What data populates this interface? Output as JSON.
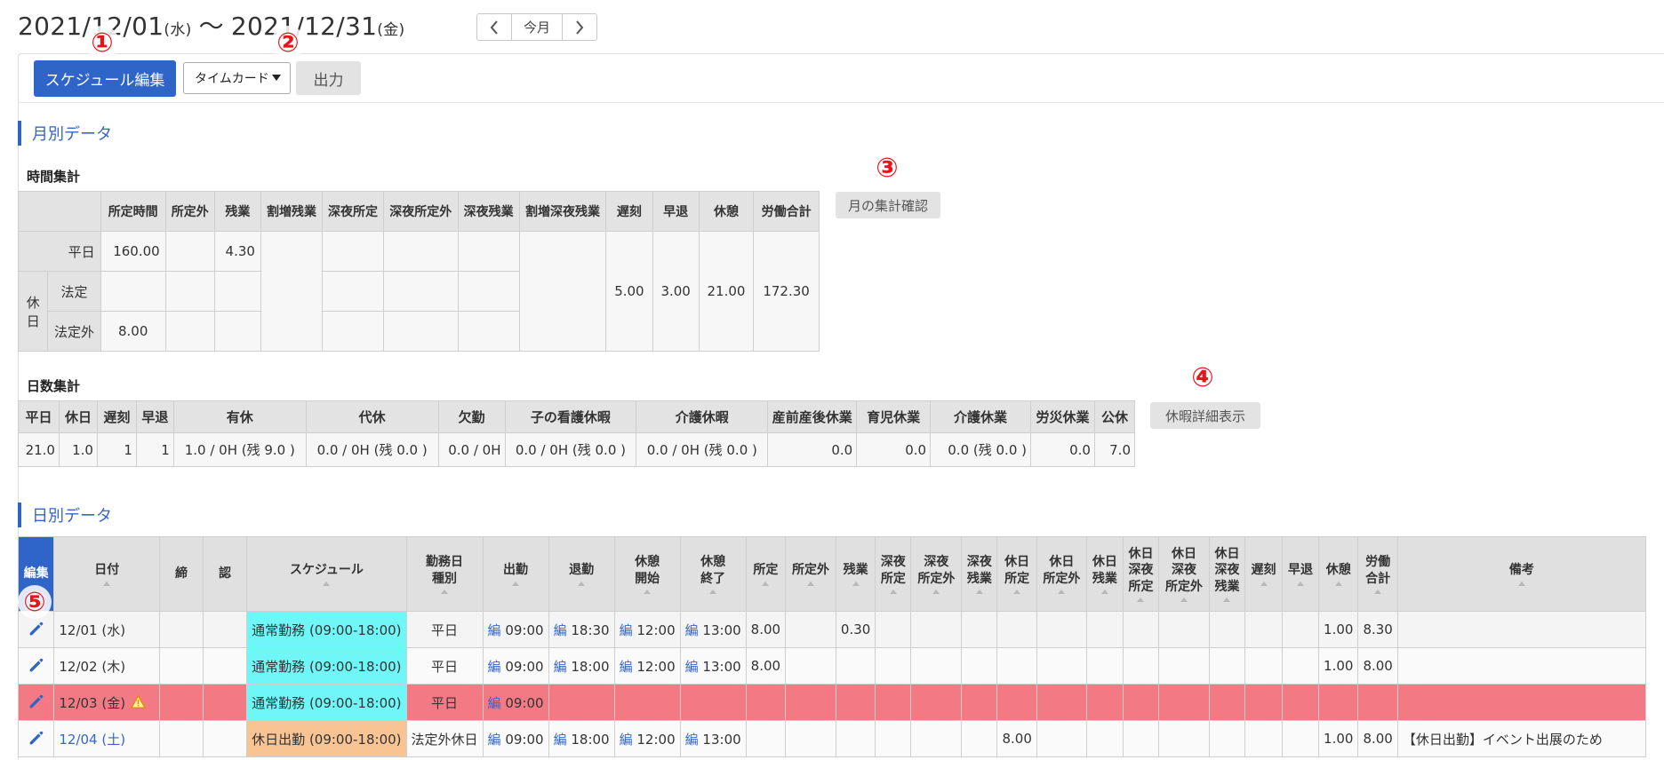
{
  "header": {
    "start_date": "2021/12/01",
    "start_dow": "(水)",
    "tilde": "〜",
    "end_date": "2021/12/31",
    "end_dow": "(金)",
    "nav_prev_icon": "chevron-left-icon",
    "nav_today": "今月",
    "nav_next_icon": "chevron-right-icon"
  },
  "toolbar": {
    "schedule_edit_label": "スケジュール編集",
    "select_value": "タイムカード",
    "output_label": "出力"
  },
  "markers": [
    "①",
    "②",
    "③",
    "④",
    "⑤"
  ],
  "monthly": {
    "section_title": "月別データ",
    "time_title": "時間集計",
    "time_headers": [
      "所定時間",
      "所定外",
      "残業",
      "割増残業",
      "深夜所定",
      "深夜所定外",
      "深夜残業",
      "割増深夜残業",
      "遅刻",
      "早退",
      "休憩",
      "労働合計"
    ],
    "row_weekday": "平日",
    "row_holiday": "休日",
    "row_legal": "法定",
    "row_nonlegal": "法定外",
    "weekday_scheduled": "160.00",
    "weekday_overtime": "4.30",
    "nonlegal_scheduled": "8.00",
    "late": "5.00",
    "early": "3.00",
    "break": "21.00",
    "total": "172.30",
    "summary_button": "月の集計確認",
    "days_title": "日数集計",
    "days_headers": [
      "平日",
      "休日",
      "遅刻",
      "早退",
      "有休",
      "代休",
      "欠勤",
      "子の看護休暇",
      "介護休暇",
      "産前産後休業",
      "育児休業",
      "介護休業",
      "労災休業",
      "公休"
    ],
    "days_values": [
      "21.0",
      "1.0",
      "1",
      "1",
      "1.0 / 0H (残 9.0 )",
      "0.0 / 0H (残 0.0 )",
      "0.0 / 0H",
      "0.0 / 0H (残 0.0 )",
      "0.0 / 0H (残 0.0 )",
      "0.0",
      "0.0",
      "0.0 (残 0.0 )",
      "0.0",
      "7.0"
    ],
    "leave_button": "休暇詳細表示"
  },
  "daily": {
    "section_title": "日別データ",
    "headers": [
      "編集",
      "日付",
      "締",
      "認",
      "スケジュール",
      "勤務日\n種別",
      "出勤",
      "退勤",
      "休憩\n開始",
      "休憩\n終了",
      "所定",
      "所定外",
      "残業",
      "深夜\n所定",
      "深夜\n所定外",
      "深夜\n残業",
      "休日\n所定",
      "休日\n所定外",
      "休日\n残業",
      "休日\n深夜\n所定",
      "休日\n深夜\n所定外",
      "休日\n深夜\n残業",
      "遅刻",
      "早退",
      "休憩",
      "労働\n合計",
      "備考"
    ],
    "edit_mark": "編",
    "rows": [
      {
        "date": "12/01 (水)",
        "schedule": "通常勤務 (09:00-18:00)",
        "type": "平日",
        "in": "09:00",
        "out": "18:30",
        "bstart": "12:00",
        "bend": "13:00",
        "sched": "8.00",
        "over": "0.30",
        "hsched": "",
        "brk": "1.00",
        "total": "8.30",
        "note": ""
      },
      {
        "date": "12/02 (木)",
        "schedule": "通常勤務 (09:00-18:00)",
        "type": "平日",
        "in": "09:00",
        "out": "18:00",
        "bstart": "12:00",
        "bend": "13:00",
        "sched": "8.00",
        "over": "",
        "hsched": "",
        "brk": "1.00",
        "total": "8.00",
        "note": ""
      },
      {
        "date": "12/03 (金)",
        "schedule": "通常勤務 (09:00-18:00)",
        "type": "平日",
        "in": "09:00",
        "out": "",
        "bstart": "",
        "bend": "",
        "sched": "",
        "over": "",
        "hsched": "",
        "brk": "",
        "total": "",
        "note": ""
      },
      {
        "date": "12/04 (土)",
        "schedule": "休日出勤 (09:00-18:00)",
        "type": "法定外休日",
        "in": "09:00",
        "out": "18:00",
        "bstart": "12:00",
        "bend": "13:00",
        "sched": "",
        "over": "",
        "hsched": "8.00",
        "brk": "1.00",
        "total": "8.00",
        "note": "【休日出勤】イベント出展のため"
      }
    ]
  }
}
